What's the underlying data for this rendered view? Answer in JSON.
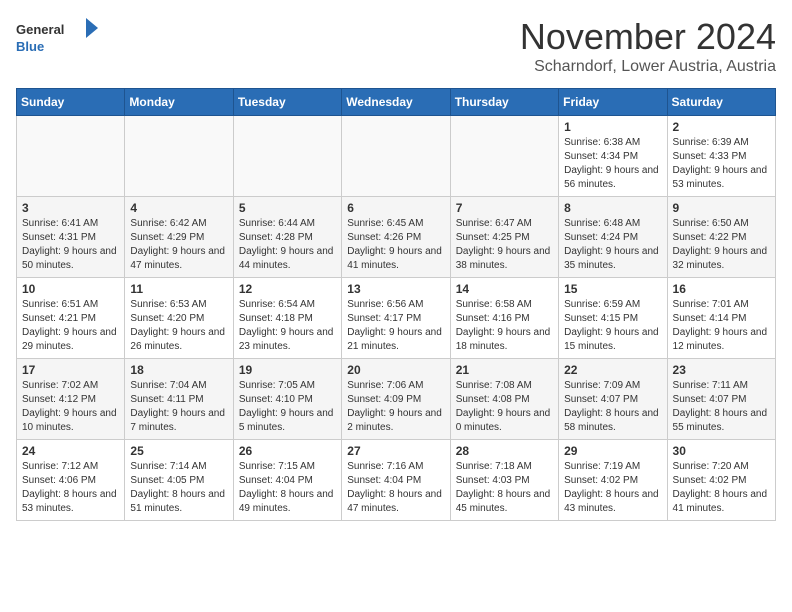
{
  "header": {
    "logo_general": "General",
    "logo_blue": "Blue",
    "month": "November 2024",
    "location": "Scharndorf, Lower Austria, Austria"
  },
  "weekdays": [
    "Sunday",
    "Monday",
    "Tuesday",
    "Wednesday",
    "Thursday",
    "Friday",
    "Saturday"
  ],
  "weeks": [
    [
      {
        "day": "",
        "info": ""
      },
      {
        "day": "",
        "info": ""
      },
      {
        "day": "",
        "info": ""
      },
      {
        "day": "",
        "info": ""
      },
      {
        "day": "",
        "info": ""
      },
      {
        "day": "1",
        "info": "Sunrise: 6:38 AM\nSunset: 4:34 PM\nDaylight: 9 hours and 56 minutes."
      },
      {
        "day": "2",
        "info": "Sunrise: 6:39 AM\nSunset: 4:33 PM\nDaylight: 9 hours and 53 minutes."
      }
    ],
    [
      {
        "day": "3",
        "info": "Sunrise: 6:41 AM\nSunset: 4:31 PM\nDaylight: 9 hours and 50 minutes."
      },
      {
        "day": "4",
        "info": "Sunrise: 6:42 AM\nSunset: 4:29 PM\nDaylight: 9 hours and 47 minutes."
      },
      {
        "day": "5",
        "info": "Sunrise: 6:44 AM\nSunset: 4:28 PM\nDaylight: 9 hours and 44 minutes."
      },
      {
        "day": "6",
        "info": "Sunrise: 6:45 AM\nSunset: 4:26 PM\nDaylight: 9 hours and 41 minutes."
      },
      {
        "day": "7",
        "info": "Sunrise: 6:47 AM\nSunset: 4:25 PM\nDaylight: 9 hours and 38 minutes."
      },
      {
        "day": "8",
        "info": "Sunrise: 6:48 AM\nSunset: 4:24 PM\nDaylight: 9 hours and 35 minutes."
      },
      {
        "day": "9",
        "info": "Sunrise: 6:50 AM\nSunset: 4:22 PM\nDaylight: 9 hours and 32 minutes."
      }
    ],
    [
      {
        "day": "10",
        "info": "Sunrise: 6:51 AM\nSunset: 4:21 PM\nDaylight: 9 hours and 29 minutes."
      },
      {
        "day": "11",
        "info": "Sunrise: 6:53 AM\nSunset: 4:20 PM\nDaylight: 9 hours and 26 minutes."
      },
      {
        "day": "12",
        "info": "Sunrise: 6:54 AM\nSunset: 4:18 PM\nDaylight: 9 hours and 23 minutes."
      },
      {
        "day": "13",
        "info": "Sunrise: 6:56 AM\nSunset: 4:17 PM\nDaylight: 9 hours and 21 minutes."
      },
      {
        "day": "14",
        "info": "Sunrise: 6:58 AM\nSunset: 4:16 PM\nDaylight: 9 hours and 18 minutes."
      },
      {
        "day": "15",
        "info": "Sunrise: 6:59 AM\nSunset: 4:15 PM\nDaylight: 9 hours and 15 minutes."
      },
      {
        "day": "16",
        "info": "Sunrise: 7:01 AM\nSunset: 4:14 PM\nDaylight: 9 hours and 12 minutes."
      }
    ],
    [
      {
        "day": "17",
        "info": "Sunrise: 7:02 AM\nSunset: 4:12 PM\nDaylight: 9 hours and 10 minutes."
      },
      {
        "day": "18",
        "info": "Sunrise: 7:04 AM\nSunset: 4:11 PM\nDaylight: 9 hours and 7 minutes."
      },
      {
        "day": "19",
        "info": "Sunrise: 7:05 AM\nSunset: 4:10 PM\nDaylight: 9 hours and 5 minutes."
      },
      {
        "day": "20",
        "info": "Sunrise: 7:06 AM\nSunset: 4:09 PM\nDaylight: 9 hours and 2 minutes."
      },
      {
        "day": "21",
        "info": "Sunrise: 7:08 AM\nSunset: 4:08 PM\nDaylight: 9 hours and 0 minutes."
      },
      {
        "day": "22",
        "info": "Sunrise: 7:09 AM\nSunset: 4:07 PM\nDaylight: 8 hours and 58 minutes."
      },
      {
        "day": "23",
        "info": "Sunrise: 7:11 AM\nSunset: 4:07 PM\nDaylight: 8 hours and 55 minutes."
      }
    ],
    [
      {
        "day": "24",
        "info": "Sunrise: 7:12 AM\nSunset: 4:06 PM\nDaylight: 8 hours and 53 minutes."
      },
      {
        "day": "25",
        "info": "Sunrise: 7:14 AM\nSunset: 4:05 PM\nDaylight: 8 hours and 51 minutes."
      },
      {
        "day": "26",
        "info": "Sunrise: 7:15 AM\nSunset: 4:04 PM\nDaylight: 8 hours and 49 minutes."
      },
      {
        "day": "27",
        "info": "Sunrise: 7:16 AM\nSunset: 4:04 PM\nDaylight: 8 hours and 47 minutes."
      },
      {
        "day": "28",
        "info": "Sunrise: 7:18 AM\nSunset: 4:03 PM\nDaylight: 8 hours and 45 minutes."
      },
      {
        "day": "29",
        "info": "Sunrise: 7:19 AM\nSunset: 4:02 PM\nDaylight: 8 hours and 43 minutes."
      },
      {
        "day": "30",
        "info": "Sunrise: 7:20 AM\nSunset: 4:02 PM\nDaylight: 8 hours and 41 minutes."
      }
    ]
  ]
}
